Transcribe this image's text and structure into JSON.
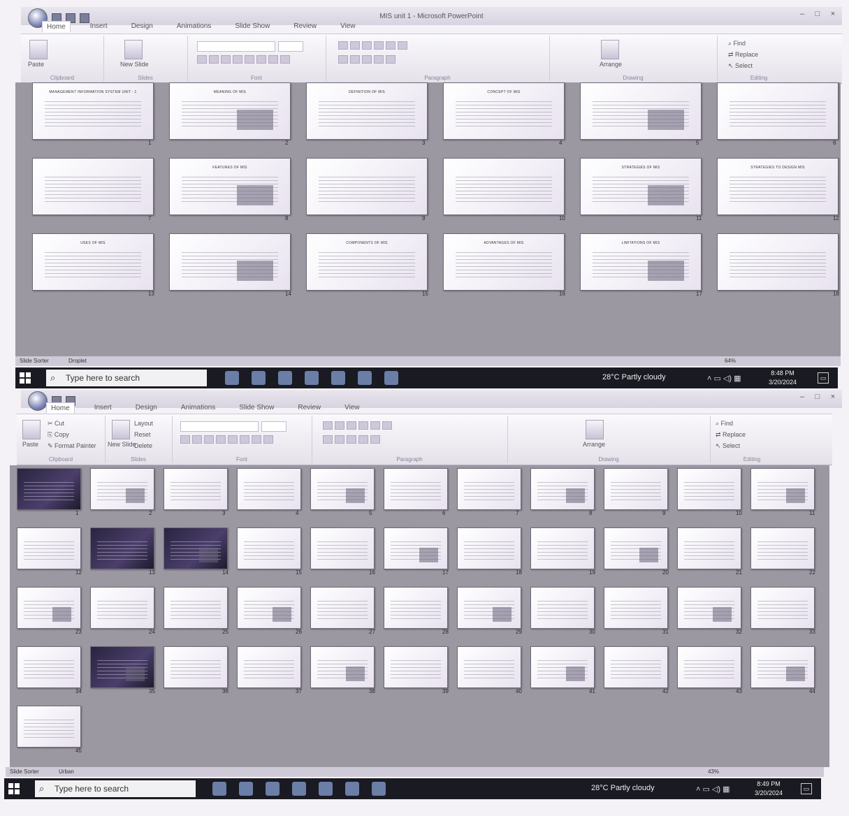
{
  "window1": {
    "title": "MIS unit 1 - Microsoft PowerPoint",
    "tabs": [
      "Home",
      "Insert",
      "Design",
      "Animations",
      "Slide Show",
      "Review",
      "View"
    ],
    "ribbon": {
      "paste": "Paste",
      "new_slide": "New Slide",
      "groups": [
        "Clipboard",
        "Slides",
        "Font",
        "Paragraph",
        "Drawing",
        "Editing"
      ],
      "arrange": "Arrange",
      "find": "Find",
      "replace": "Replace",
      "select": "Select"
    },
    "slides": [
      {
        "n": "1",
        "t": "Management Information System Unit - 1"
      },
      {
        "n": "2",
        "t": "Meaning of MIS"
      },
      {
        "n": "3",
        "t": "Definition of MIS"
      },
      {
        "n": "4",
        "t": "Concept of MIS"
      },
      {
        "n": "5",
        "t": ""
      },
      {
        "n": "6",
        "t": ""
      },
      {
        "n": "7",
        "t": ""
      },
      {
        "n": "8",
        "t": "Features of MIS"
      },
      {
        "n": "9",
        "t": ""
      },
      {
        "n": "10",
        "t": ""
      },
      {
        "n": "11",
        "t": "Strategies of MIS"
      },
      {
        "n": "12",
        "t": "Strategies to Design MIS"
      },
      {
        "n": "13",
        "t": "Uses of MIS"
      },
      {
        "n": "14",
        "t": ""
      },
      {
        "n": "15",
        "t": "Components of MIS"
      },
      {
        "n": "16",
        "t": "Advantages of MIS"
      },
      {
        "n": "17",
        "t": "Limitations of MIS"
      },
      {
        "n": "18",
        "t": ""
      }
    ],
    "status": {
      "view": "Slide Sorter",
      "theme": "Droplet",
      "zoom": "64%"
    }
  },
  "taskbar1": {
    "search_placeholder": "Type here to search",
    "weather": "28°C  Partly cloudy",
    "time": "8:48 PM",
    "date": "3/20/2024"
  },
  "window2": {
    "tabs": [
      "Home",
      "Insert",
      "Design",
      "Animations",
      "Slide Show",
      "Review",
      "View"
    ],
    "ribbon": {
      "cut": "Cut",
      "copy": "Copy",
      "format_painter": "Format Painter",
      "paste": "Paste",
      "new_slide": "New Slide",
      "layout": "Layout",
      "reset": "Reset",
      "delete": "Delete",
      "groups": [
        "Clipboard",
        "Slides",
        "Font",
        "Paragraph",
        "Drawing",
        "Editing"
      ],
      "arrange": "Arrange",
      "find": "Find",
      "replace": "Replace",
      "select": "Select"
    },
    "slides": [
      "1",
      "2",
      "3",
      "4",
      "5",
      "6",
      "7",
      "8",
      "9",
      "10",
      "11",
      "12",
      "13",
      "14",
      "15",
      "16",
      "17",
      "18",
      "19",
      "20",
      "21",
      "22",
      "23",
      "24",
      "25",
      "26",
      "27",
      "28",
      "29",
      "30",
      "31",
      "32",
      "33",
      "34",
      "35",
      "36",
      "37",
      "38",
      "39",
      "40",
      "41",
      "42",
      "43",
      "44",
      "45"
    ],
    "dark_slides": [
      "1",
      "13",
      "14",
      "35"
    ],
    "status": {
      "view": "Slide Sorter",
      "theme": "Urban",
      "zoom": "43%"
    }
  },
  "taskbar2": {
    "search_placeholder": "Type here to search",
    "weather": "28°C  Partly cloudy",
    "time": "8:49 PM",
    "date": "3/20/2024"
  }
}
